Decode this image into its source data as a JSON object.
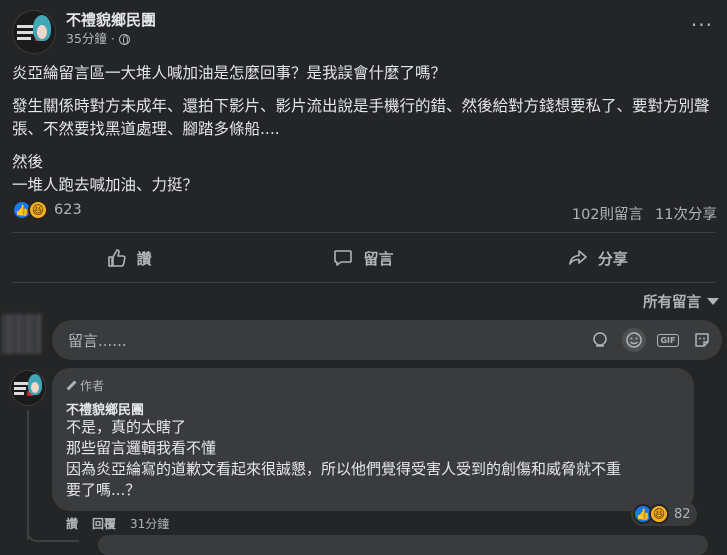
{
  "post": {
    "page_name": "不禮貌鄉民團",
    "time": "35分鐘",
    "paragraphs": [
      "炎亞綸留言區一大堆人喊加油是怎麼回事？是我誤會什麼了嗎？",
      "發生關係時對方未成年、還拍下影片、影片流出說是手機行的錯、然後給對方錢想要私了、要對方別聲張、不然要找黑道處理、腳踏多條船....",
      "然後",
      "一堆人跑去喊加油、力挺？"
    ],
    "reactions_count": "623",
    "comments_count": "102則留言",
    "shares_count": "11次分享"
  },
  "actions": {
    "like": "讚",
    "comment": "留言",
    "share": "分享"
  },
  "sort_label": "所有留言",
  "comment_box": {
    "placeholder": "留言......"
  },
  "comment": {
    "badge": "作者",
    "name": "不禮貌鄉民團",
    "lines": [
      "不是，真的太瞎了",
      "那些留言邏輯我看不懂",
      "因為炎亞綸寫的道歉文看起來很誠懇，所以他們覺得受害人受到的創傷和威脅就不重",
      "要了嗎...？"
    ],
    "reactions_count": "82",
    "like_label": "讚",
    "reply_label": "回覆",
    "time": "31分鐘"
  },
  "icons": {
    "like": "thumbs-up-icon",
    "comment": "speech-bubble-icon",
    "share": "share-arrow-icon",
    "globe": "globe-icon",
    "more": "more-dots-icon"
  },
  "colors": {
    "background": "#242526",
    "surface": "#3a3b3c",
    "text": "#e4e6eb",
    "secondary_text": "#b0b3b8",
    "like_blue": "#1877f2",
    "haha_yellow": "#f7b125"
  }
}
